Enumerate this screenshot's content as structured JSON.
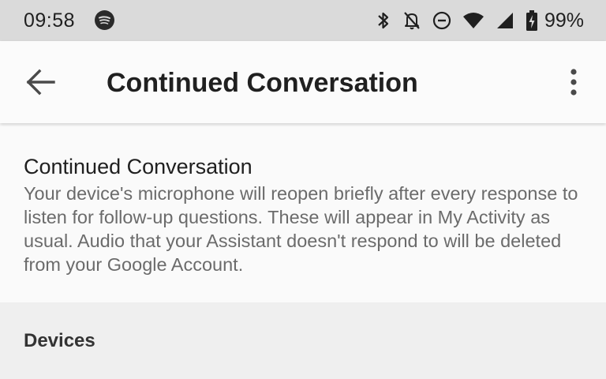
{
  "status_bar": {
    "time": "09:58",
    "battery_percent": "99%",
    "icons": [
      "spotify-icon",
      "bluetooth-icon",
      "notifications-off-icon",
      "do-not-disturb-icon",
      "wifi-icon",
      "cellular-signal-icon",
      "battery-charging-icon"
    ]
  },
  "app_bar": {
    "title": "Continued Conversation",
    "back_icon": "arrow-back-icon",
    "menu_icon": "more-vert-icon"
  },
  "setting": {
    "title": "Continued Conversation",
    "description": "Your device's microphone will reopen briefly after every response to listen for follow-up questions. These will appear in My Activity as usual. Audio that your Assistant doesn't respond to will be deleted from your Google Account."
  },
  "devices": {
    "header": "Devices"
  }
}
